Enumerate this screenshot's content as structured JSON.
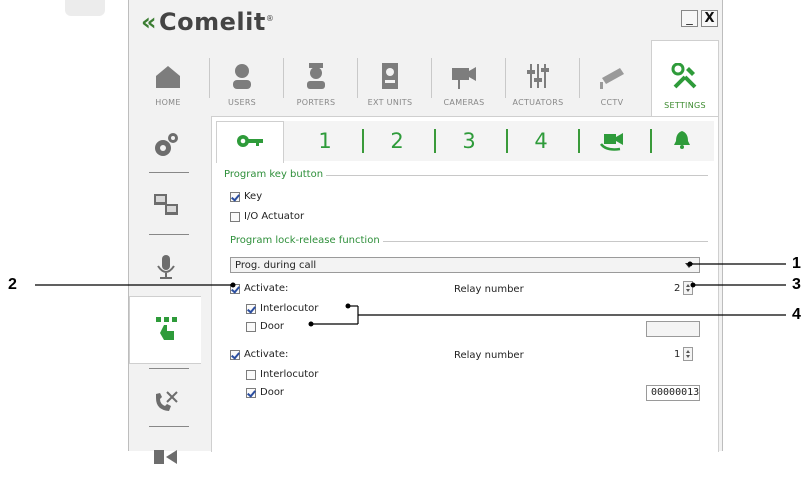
{
  "app": {
    "logo_text": "Comelit",
    "logo_mark": "«",
    "logo_reg": "®",
    "minimize_label": "_",
    "close_label": "X"
  },
  "topnav": [
    {
      "label": "HOME",
      "icon": "home-icon"
    },
    {
      "label": "USERS",
      "icon": "user-icon"
    },
    {
      "label": "PORTERS",
      "icon": "porter-icon"
    },
    {
      "label": "EXT UNITS",
      "icon": "ext-unit-icon"
    },
    {
      "label": "CAMERAS",
      "icon": "camera-icon"
    },
    {
      "label": "ACTUATORS",
      "icon": "actuator-icon"
    },
    {
      "label": "CCTV",
      "icon": "cctv-icon"
    },
    {
      "label": "SETTINGS",
      "icon": "settings-icon",
      "active": true
    }
  ],
  "sidenav": [
    {
      "icon": "gears-icon"
    },
    {
      "icon": "monitors-icon"
    },
    {
      "icon": "microphone-icon"
    },
    {
      "icon": "keypad-touch-icon",
      "active": true
    },
    {
      "icon": "phone-tools-icon"
    },
    {
      "icon": "sequence-icon"
    }
  ],
  "subtabs": [
    {
      "icon": "key-icon",
      "active": true
    },
    {
      "label": "1"
    },
    {
      "label": "2"
    },
    {
      "label": "3"
    },
    {
      "label": "4"
    },
    {
      "icon": "video-rotate-icon"
    },
    {
      "icon": "bell-icon"
    }
  ],
  "form": {
    "section1_title": "Program key button",
    "key_label": "Key",
    "key_checked": true,
    "io_label": "I/O Actuator",
    "io_checked": false,
    "section2_title": "Program lock-release function",
    "dropdown_value": "Prog. during call",
    "group1": {
      "activate_label": "Activate:",
      "activate_checked": true,
      "relay_label": "Relay number",
      "relay_value": "2",
      "interlocutor_label": "Interlocutor",
      "interlocutor_checked": true,
      "door_label": "Door",
      "door_checked": false,
      "door_value": ""
    },
    "group2": {
      "activate_label": "Activate:",
      "activate_checked": true,
      "relay_label": "Relay number",
      "relay_value": "1",
      "interlocutor_label": "Interlocutor",
      "interlocutor_checked": false,
      "door_label": "Door",
      "door_checked": true,
      "door_value": "00000013"
    }
  },
  "callouts": {
    "c1": "1",
    "c2": "2",
    "c3": "3",
    "c4": "4"
  },
  "colors": {
    "accent_green": "#2e9b3a",
    "section_green": "#2e8f3a",
    "check_blue": "#2b4ea0"
  }
}
